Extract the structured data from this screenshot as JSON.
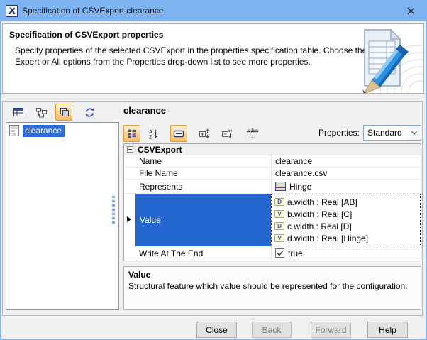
{
  "window": {
    "title": "Specification of CSVExport clearance"
  },
  "header": {
    "title": "Specification of CSVExport properties",
    "line1": "Specify properties of the selected CSVExport in the properties specification table. Choose the",
    "line2": "Expert or All options from the Properties drop-down list to see more properties."
  },
  "tree": {
    "selected_item": "clearance"
  },
  "panel": {
    "title": "clearance",
    "properties_label": "Properties:",
    "properties_value": "Standard"
  },
  "toolbar_icons": {
    "left": [
      "properties-table-icon",
      "tree-structure-icon",
      "cascade-windows-icon",
      "refresh-icon"
    ],
    "right": [
      "categorized-view-icon",
      "sort-alphabetically-icon",
      "description-area-icon",
      "expand-icon",
      "collapse-icon",
      "filter-abc-icon"
    ],
    "abc_label": "abc",
    "dots_label": "..."
  },
  "table": {
    "group": "CSVExport",
    "rows": [
      {
        "label": "Name",
        "value": "clearance"
      },
      {
        "label": "File Name",
        "value": "clearance.csv"
      },
      {
        "label": "Represents",
        "value": "Hinge"
      },
      {
        "label": "Value",
        "items": [
          {
            "icon": "D",
            "text": "a.width : Real [AB]"
          },
          {
            "icon": "V",
            "text": "b.width : Real [C]"
          },
          {
            "icon": "D",
            "text": "c.width : Real [D]"
          },
          {
            "icon": "V",
            "text": "d.width : Real [Hinge]"
          }
        ]
      },
      {
        "label": "Write At The End",
        "value": "true"
      }
    ]
  },
  "description": {
    "title": "Value",
    "text": "Structural feature which value should be represented for the configuration."
  },
  "buttons": {
    "close": "Close",
    "back": "Back",
    "forward": "Forward",
    "help": "Help"
  },
  "colors": {
    "accent_titlebar": "#7db3f1",
    "selection_blue": "#2468cf",
    "toolbar_active_orange": "#dd9f3d"
  }
}
